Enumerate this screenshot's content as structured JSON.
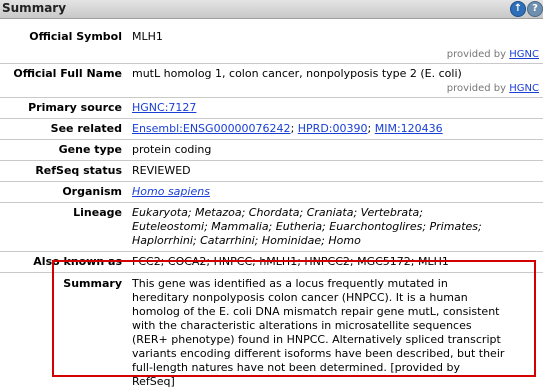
{
  "header": {
    "title": "Summary",
    "up_icon": "arrow-up-icon",
    "help_icon": "help-icon"
  },
  "rows": {
    "official_symbol": {
      "label": "Official Symbol",
      "value": "MLH1",
      "provided_by": "provided by",
      "provider": "HGNC"
    },
    "official_full_name": {
      "label": "Official Full Name",
      "value": "mutL homolog 1, colon cancer, nonpolyposis type 2 (E. coli)",
      "provided_by": "provided by",
      "provider": "HGNC"
    },
    "primary_source": {
      "label": "Primary source",
      "link": "HGNC:7127"
    },
    "see_related": {
      "label": "See related",
      "links": [
        "Ensembl:ENSG00000076242",
        "HPRD:00390",
        "MIM:120436"
      ],
      "sep": ";"
    },
    "gene_type": {
      "label": "Gene type",
      "value": "protein coding"
    },
    "refseq_status": {
      "label": "RefSeq status",
      "value": "REVIEWED"
    },
    "organism": {
      "label": "Organism",
      "link": "Homo sapiens"
    },
    "lineage": {
      "label": "Lineage",
      "lines": [
        "Eukaryota; Metazoa; Chordata; Craniata; Vertebrata;",
        "Euteleostomi; Mammalia; Eutheria; Euarchontoglires; Primates;",
        "Haplorrhini; Catarrhini; Hominidae; Homo"
      ]
    },
    "also_known_as": {
      "label": "Also known as",
      "value": "FCC2; COCA2; HNPCC; hMLH1; HNPCC2; MGC5172; MLH1"
    },
    "summary": {
      "label": "Summary",
      "lines": [
        "This gene was identified as a locus frequently mutated in",
        "hereditary nonpolyposis colon cancer (HNPCC).  It is a human",
        "homolog of the E. coli DNA mismatch repair gene mutL, consistent",
        "with the characteristic alterations in microsatellite sequences",
        "(RER+ phenotype) found in HNPCC. Alternatively spliced transcript",
        "variants encoding different isoforms have been described, but their",
        "full-length natures have not been determined. [provided by",
        "RefSeq]"
      ]
    }
  },
  "colors": {
    "link": "#1a3fd6",
    "highlight_border": "#d40000",
    "header_bg": "#d6d6d6"
  }
}
